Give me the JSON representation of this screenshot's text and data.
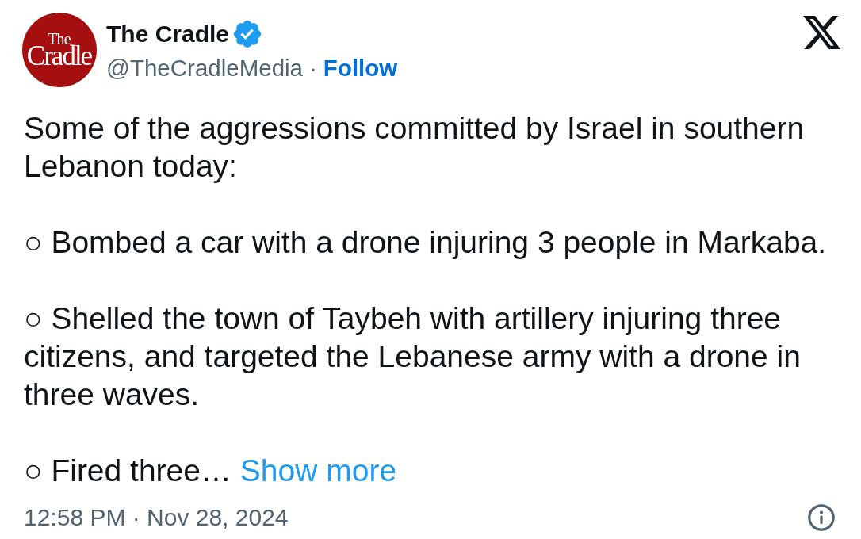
{
  "header": {
    "avatar": {
      "logo_lines": [
        "The",
        "Cradle"
      ]
    },
    "name": "The Cradle",
    "verified": true,
    "handle": "@TheCradleMedia",
    "separator": "·",
    "follow_label": "Follow"
  },
  "tweet": {
    "paragraphs": [
      "Some of the aggressions committed by Israel in southern Lebanon today:",
      "○ Bombed a car with a drone injuring 3 people in Markaba.",
      "○ Shelled the town of Taybeh with artillery injuring three citizens, and targeted the Lebanese army with a drone in three waves.",
      "○ Fired three…"
    ],
    "show_more": "Show more"
  },
  "footer": {
    "timestamp": "12:58 PM · Nov 28, 2024"
  }
}
